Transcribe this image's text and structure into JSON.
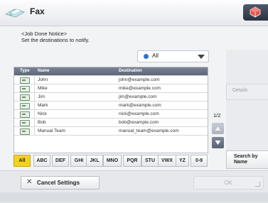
{
  "header": {
    "title": "Fax",
    "fax_icon": "fax-icon",
    "home_icon": "home-icon"
  },
  "instruction": {
    "line1": "<Job Done Notice>",
    "line2": "Set the destinations to notify."
  },
  "filter": {
    "selected": "All"
  },
  "table": {
    "columns": [
      "Type",
      "Name",
      "Destination"
    ],
    "rows": [
      {
        "name": "John",
        "destination": "john@example.com"
      },
      {
        "name": "Mike",
        "destination": "mike@example.com"
      },
      {
        "name": "Jim",
        "destination": "jim@example.com"
      },
      {
        "name": "Mark",
        "destination": "mark@example.com"
      },
      {
        "name": "Nick",
        "destination": "nick@example.com"
      },
      {
        "name": "Bob",
        "destination": "bob@example.com"
      },
      {
        "name": "Manual Team",
        "destination": "manual_team@example.com"
      }
    ]
  },
  "pagination": {
    "indicator": "1/2"
  },
  "side": {
    "details": "Details",
    "search_by_name_1": "Search by",
    "search_by_name_2": "Name"
  },
  "tabs": [
    "All",
    "ABC",
    "DEF",
    "GHI",
    "JKL",
    "MNO",
    "PQR",
    "STU",
    "VWX",
    "YZ",
    "0-9"
  ],
  "footer": {
    "cancel": "Cancel Settings",
    "ok": "OK"
  },
  "colors": {
    "active_tab": "#f2d21c",
    "header_bar": "#5d6676",
    "accent_blue": "#2f6fd1"
  }
}
